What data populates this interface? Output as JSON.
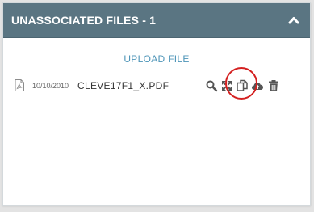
{
  "panel": {
    "title": "UNASSOCIATED FILES - 1",
    "upload_label": "UPLOAD FILE",
    "header_color": "#5a7582",
    "link_color": "#4e95b8"
  },
  "files": [
    {
      "date": "10/10/2010",
      "name": "CLEVE17F1_X.PDF",
      "icon": "pdf-file-icon",
      "actions": [
        {
          "icon": "search-icon",
          "name": "preview-file-button"
        },
        {
          "icon": "expand-icon",
          "name": "expand-file-button"
        },
        {
          "icon": "copy-icon",
          "name": "copy-file-button"
        },
        {
          "icon": "cloud-icon",
          "name": "cloud-file-button"
        },
        {
          "icon": "trash-icon",
          "name": "delete-file-button"
        }
      ]
    }
  ],
  "annotation": {
    "highlight_color": "#d42020",
    "highlighted_action": "copy-file-button"
  }
}
